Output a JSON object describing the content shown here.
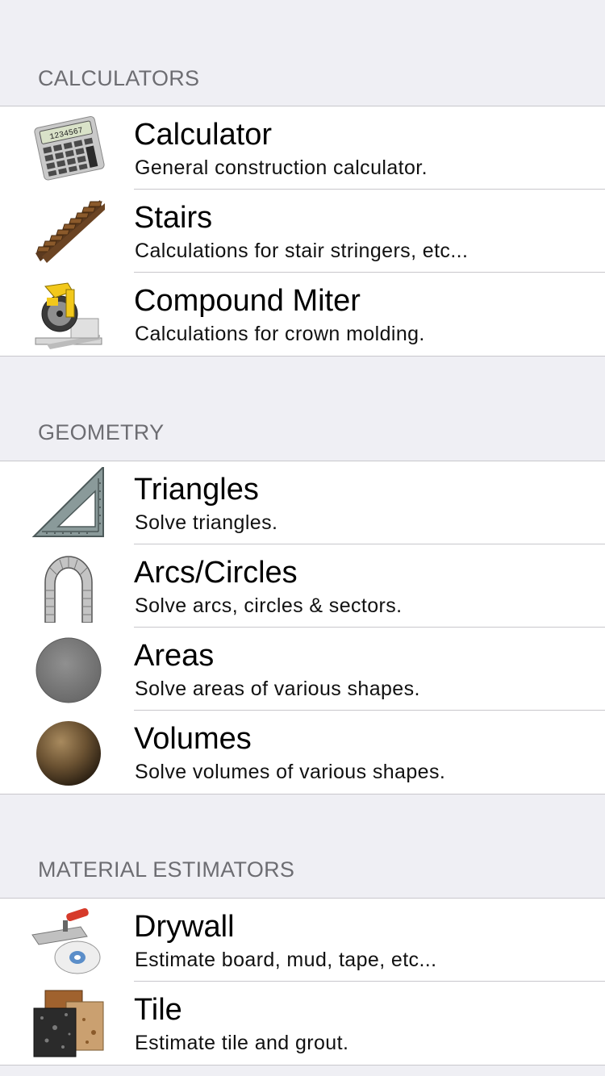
{
  "sections": [
    {
      "header": "CALCULATORS",
      "items": [
        {
          "title": "Calculator",
          "subtitle": "General construction calculator.",
          "icon": "calculator-icon"
        },
        {
          "title": "Stairs",
          "subtitle": "Calculations for stair stringers, etc...",
          "icon": "stairs-icon"
        },
        {
          "title": "Compound Miter",
          "subtitle": "Calculations for crown molding.",
          "icon": "miter-saw-icon"
        }
      ]
    },
    {
      "header": "GEOMETRY",
      "items": [
        {
          "title": "Triangles",
          "subtitle": "Solve triangles.",
          "icon": "speed-square-icon"
        },
        {
          "title": "Arcs/Circles",
          "subtitle": "Solve arcs, circles & sectors.",
          "icon": "arch-icon"
        },
        {
          "title": "Areas",
          "subtitle": "Solve areas of various shapes.",
          "icon": "gray-disc-icon"
        },
        {
          "title": "Volumes",
          "subtitle": "Solve volumes of various shapes.",
          "icon": "sphere-icon"
        }
      ]
    },
    {
      "header": "MATERIAL ESTIMATORS",
      "items": [
        {
          "title": "Drywall",
          "subtitle": "Estimate board, mud, tape, etc...",
          "icon": "trowel-tape-icon"
        },
        {
          "title": "Tile",
          "subtitle": "Estimate tile and grout.",
          "icon": "tiles-icon"
        }
      ]
    }
  ],
  "colors": {
    "background": "#efeff4",
    "separator": "#c8c7cc",
    "header_text": "#6d6d72"
  }
}
